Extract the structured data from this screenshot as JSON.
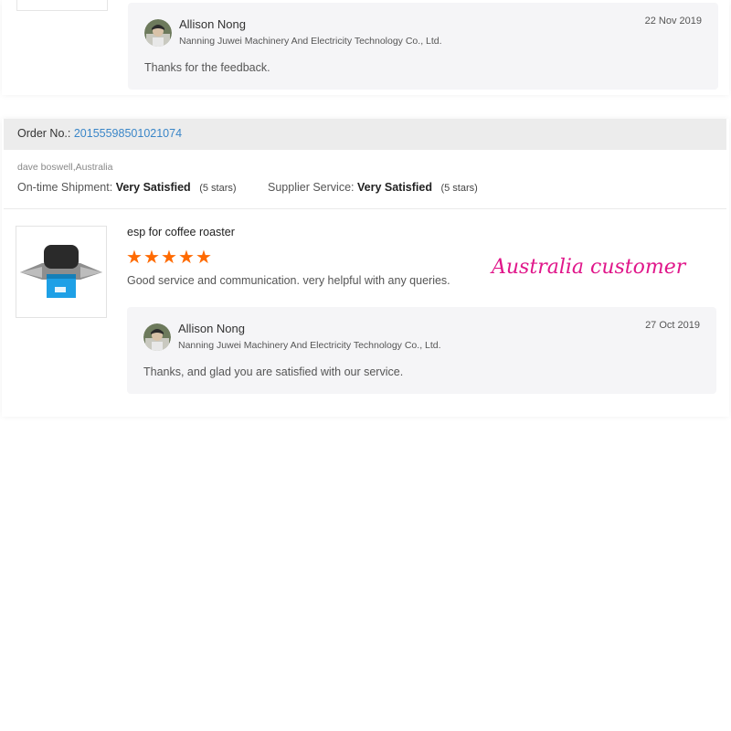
{
  "previous_review": {
    "reply": {
      "name": "Allison Nong",
      "company": "Nanning Juwei Machinery And Electricity Technology Co., Ltd.",
      "date": "22 Nov 2019",
      "text": "Thanks for the feedback."
    }
  },
  "order": {
    "label": "Order No.:",
    "number": "20155598501021074"
  },
  "buyer": "dave boswell,Australia",
  "ratings": {
    "shipment_label": "On-time Shipment:",
    "shipment_value": "Very Satisfied",
    "shipment_stars": "(5 stars)",
    "service_label": "Supplier Service:",
    "service_value": "Very Satisfied",
    "service_stars": "(5 stars)"
  },
  "review": {
    "product_title": "esp for coffee roaster",
    "stars": 5,
    "text": "Good service and communication. very helpful with any queries.",
    "annotation": "Australia customer",
    "reply": {
      "name": "Allison Nong",
      "company": "Nanning Juwei Machinery And Electricity Technology Co., Ltd.",
      "date": "27 Oct 2019",
      "text": "Thanks, and glad you are satisfied with our service."
    }
  },
  "colors": {
    "star": "#ff6a00",
    "link": "#3a86c8",
    "annotation": "#e0168a",
    "reply_bg": "#f5f5f7",
    "order_bar_bg": "#ececec"
  },
  "icons": [
    "avatar",
    "star-icon",
    "product-image"
  ]
}
